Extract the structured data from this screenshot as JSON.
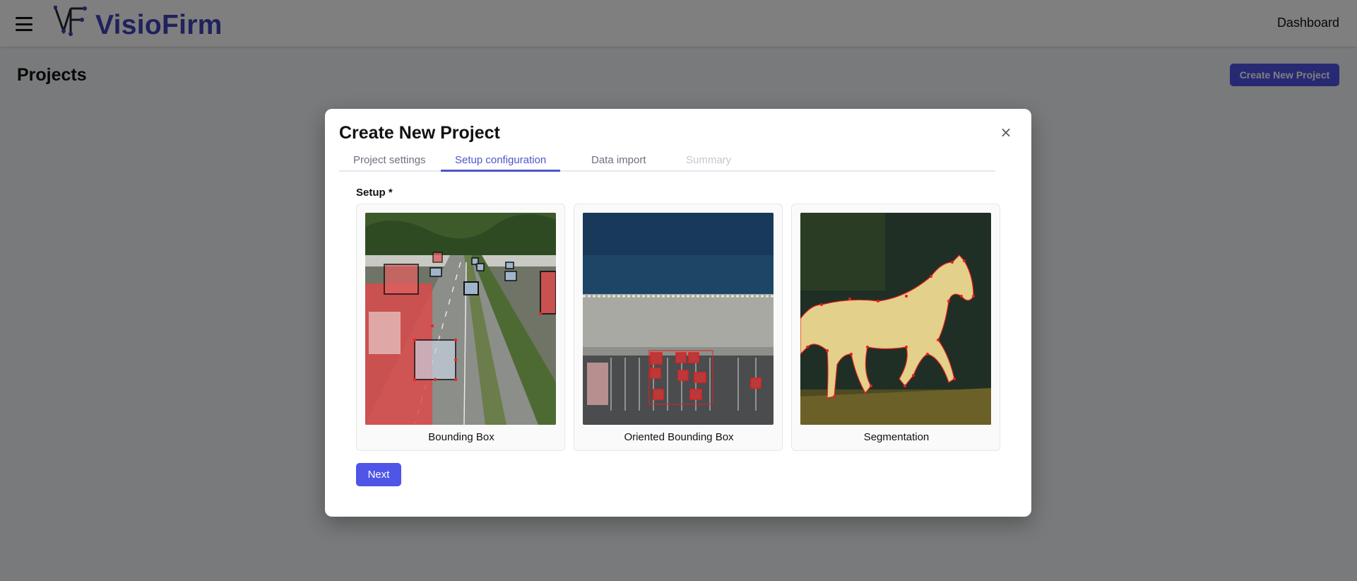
{
  "app": {
    "brand": "VisioFirm",
    "nav_dashboard": "Dashboard",
    "page_title": "Projects",
    "create_button": "Create New Project",
    "accent_color": "#4f55e6"
  },
  "modal": {
    "title": "Create New Project",
    "close_icon": "×",
    "tabs": [
      {
        "label": "Project settings",
        "state": "default"
      },
      {
        "label": "Setup configuration",
        "state": "active"
      },
      {
        "label": "Data import",
        "state": "default"
      },
      {
        "label": "Summary",
        "state": "disabled"
      }
    ],
    "setup_label": "Setup *",
    "options": [
      {
        "label": "Bounding Box",
        "icon": "highway-bounding-box-image"
      },
      {
        "label": "Oriented Bounding Box",
        "icon": "parking-lot-aerial-image"
      },
      {
        "label": "Segmentation",
        "icon": "horse-segmentation-image"
      }
    ],
    "next_button": "Next"
  }
}
